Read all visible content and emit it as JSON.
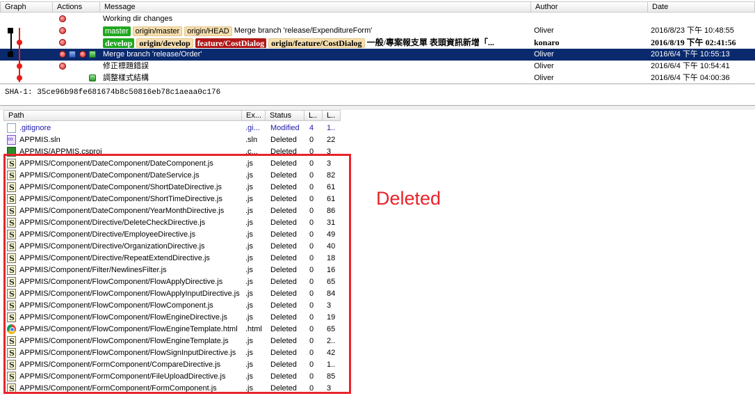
{
  "commit_grid": {
    "columns": {
      "graph": "Graph",
      "actions": "Actions",
      "message": "Message",
      "author": "Author",
      "date": "Date"
    },
    "rows": [
      {
        "message": "Working dir changes",
        "author": "",
        "date": ""
      },
      {
        "tags": [
          {
            "text": "master",
            "color": "green"
          },
          {
            "text": "origin/master",
            "color": "yellow"
          },
          {
            "text": "origin/HEAD",
            "color": "yellow"
          }
        ],
        "message": "Merge branch 'release/ExpenditureForm'",
        "author": "Oliver",
        "date": "2016/8/23 下午 10:48:55"
      },
      {
        "tags": [
          {
            "text": "develop",
            "color": "green"
          },
          {
            "text": "origin/develop",
            "color": "yellow"
          },
          {
            "text": "feature/CostDialog",
            "color": "red"
          },
          {
            "text": "origin/feature/CostDialog",
            "color": "yellow"
          }
        ],
        "message": "一般/專案報支單 表頭資訊新增「...",
        "author": "konaro",
        "date": "2016/8/19 下午 02:41:56"
      },
      {
        "message": "Merge branch 'release/Order'",
        "author": "Oliver",
        "date": "2016/6/4 下午 10:55:13"
      },
      {
        "message": "修正標題錯誤",
        "author": "Oliver",
        "date": "2016/6/4 下午 10:54:41"
      },
      {
        "message": "調整樣式結構",
        "author": "Oliver",
        "date": "2016/6/4 下午 04:00:36"
      }
    ]
  },
  "sha": {
    "text": "SHA-1: 35ce96b98fe681674b8c50816eb78c1aeaa0c176"
  },
  "file_list": {
    "columns": {
      "path": "Path",
      "ext": "Ex...",
      "status": "Status",
      "l1": "L..",
      "l2": "L.."
    },
    "files": [
      {
        "path": ".gitignore",
        "ext": ".gi...",
        "status": "Modified",
        "l1": "4",
        "l2": "1..",
        "icon": "doc"
      },
      {
        "path": "APPMIS.sln",
        "ext": ".sln",
        "status": "Deleted",
        "l1": "0",
        "l2": "22",
        "icon": "sln"
      },
      {
        "path": "APPMIS/APPMIS.csproj",
        "ext": ".c...",
        "status": "Deleted",
        "l1": "0",
        "l2": "3",
        "icon": "proj"
      },
      {
        "path": "APPMIS/Component/DateComponent/DateComponent.js",
        "ext": ".js",
        "status": "Deleted",
        "l1": "0",
        "l2": "3",
        "icon": "js"
      },
      {
        "path": "APPMIS/Component/DateComponent/DateService.js",
        "ext": ".js",
        "status": "Deleted",
        "l1": "0",
        "l2": "82",
        "icon": "js"
      },
      {
        "path": "APPMIS/Component/DateComponent/ShortDateDirective.js",
        "ext": ".js",
        "status": "Deleted",
        "l1": "0",
        "l2": "61",
        "icon": "js"
      },
      {
        "path": "APPMIS/Component/DateComponent/ShortTimeDirective.js",
        "ext": ".js",
        "status": "Deleted",
        "l1": "0",
        "l2": "61",
        "icon": "js"
      },
      {
        "path": "APPMIS/Component/DateComponent/YearMonthDirective.js",
        "ext": ".js",
        "status": "Deleted",
        "l1": "0",
        "l2": "86",
        "icon": "js"
      },
      {
        "path": "APPMIS/Component/Directive/DeleteCheckDirective.js",
        "ext": ".js",
        "status": "Deleted",
        "l1": "0",
        "l2": "31",
        "icon": "js"
      },
      {
        "path": "APPMIS/Component/Directive/EmployeeDirective.js",
        "ext": ".js",
        "status": "Deleted",
        "l1": "0",
        "l2": "49",
        "icon": "js"
      },
      {
        "path": "APPMIS/Component/Directive/OrganizationDirective.js",
        "ext": ".js",
        "status": "Deleted",
        "l1": "0",
        "l2": "40",
        "icon": "js"
      },
      {
        "path": "APPMIS/Component/Directive/RepeatExtendDirective.js",
        "ext": ".js",
        "status": "Deleted",
        "l1": "0",
        "l2": "18",
        "icon": "js"
      },
      {
        "path": "APPMIS/Component/Filter/NewlinesFilter.js",
        "ext": ".js",
        "status": "Deleted",
        "l1": "0",
        "l2": "16",
        "icon": "js"
      },
      {
        "path": "APPMIS/Component/FlowComponent/FlowApplyDirective.js",
        "ext": ".js",
        "status": "Deleted",
        "l1": "0",
        "l2": "65",
        "icon": "js"
      },
      {
        "path": "APPMIS/Component/FlowComponent/FlowApplyInputDirective.js",
        "ext": ".js",
        "status": "Deleted",
        "l1": "0",
        "l2": "84",
        "icon": "js"
      },
      {
        "path": "APPMIS/Component/FlowComponent/FlowComponent.js",
        "ext": ".js",
        "status": "Deleted",
        "l1": "0",
        "l2": "3",
        "icon": "js"
      },
      {
        "path": "APPMIS/Component/FlowComponent/FlowEngineDirective.js",
        "ext": ".js",
        "status": "Deleted",
        "l1": "0",
        "l2": "19",
        "icon": "js"
      },
      {
        "path": "APPMIS/Component/FlowComponent/FlowEngineTemplate.html",
        "ext": ".html",
        "status": "Deleted",
        "l1": "0",
        "l2": "65",
        "icon": "html"
      },
      {
        "path": "APPMIS/Component/FlowComponent/FlowEngineTemplate.js",
        "ext": ".js",
        "status": "Deleted",
        "l1": "0",
        "l2": "2..",
        "icon": "js"
      },
      {
        "path": "APPMIS/Component/FlowComponent/FlowSignInputDirective.js",
        "ext": ".js",
        "status": "Deleted",
        "l1": "0",
        "l2": "42",
        "icon": "js"
      },
      {
        "path": "APPMIS/Component/FormComponent/CompareDirective.js",
        "ext": ".js",
        "status": "Deleted",
        "l1": "0",
        "l2": "1..",
        "icon": "js"
      },
      {
        "path": "APPMIS/Component/FormComponent/FileUploadDirective.js",
        "ext": ".js",
        "status": "Deleted",
        "l1": "0",
        "l2": "85",
        "icon": "js"
      },
      {
        "path": "APPMIS/Component/FormComponent/FormComponent.js",
        "ext": ".js",
        "status": "Deleted",
        "l1": "0",
        "l2": "3",
        "icon": "js"
      }
    ]
  },
  "annotation": {
    "label": "Deleted",
    "color": "#e8232a"
  }
}
